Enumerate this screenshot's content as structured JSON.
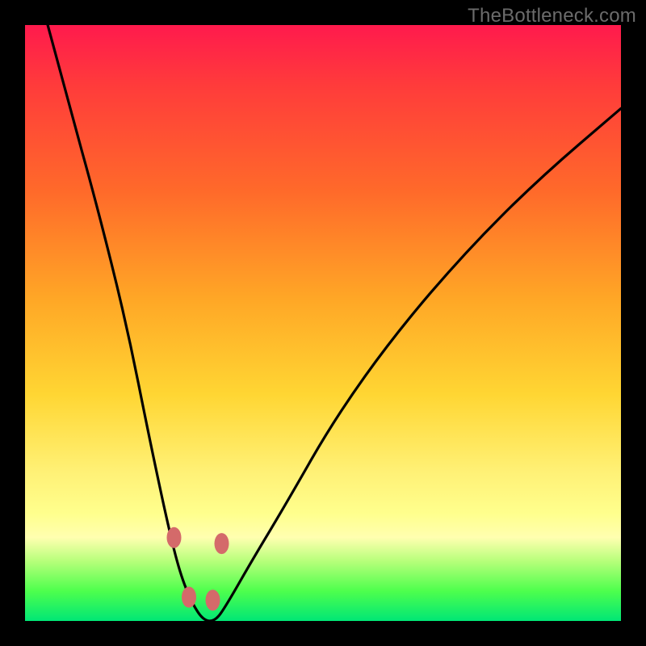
{
  "watermark": "TheBottleneck.com",
  "colors": {
    "frame_bg_top": "#ff1a4d",
    "frame_bg_bottom": "#00e676",
    "curve": "#000000",
    "marker": "#d46a6a",
    "page_bg": "#000000",
    "watermark": "#6b6b6b"
  },
  "chart_data": {
    "type": "line",
    "title": "",
    "xlabel": "",
    "ylabel": "",
    "xlim": [
      0,
      100
    ],
    "ylim": [
      0,
      100
    ],
    "note": "V-shaped bottleneck curve with gradient heat background; axes unlabeled; values estimated from pixel positions on a 0–100 normalized scale where y=0 is the top of the plot and y=100 is the bottom (green zone).",
    "series": [
      {
        "name": "bottleneck-curve",
        "x": [
          3,
          7,
          12,
          17,
          21,
          24,
          26,
          28,
          30,
          32,
          34,
          38,
          44,
          52,
          62,
          74,
          86,
          100
        ],
        "y": [
          -3,
          12,
          30,
          50,
          70,
          84,
          92,
          97,
          100,
          100,
          97,
          90,
          80,
          66,
          52,
          38,
          26,
          14
        ]
      }
    ],
    "markers": [
      {
        "name": "left-upper",
        "x": 25.0,
        "y": 86.0
      },
      {
        "name": "left-lower",
        "x": 27.5,
        "y": 96.0
      },
      {
        "name": "right-lower",
        "x": 31.5,
        "y": 96.5
      },
      {
        "name": "right-upper",
        "x": 33.0,
        "y": 87.0
      }
    ],
    "legend": null,
    "grid": false
  }
}
